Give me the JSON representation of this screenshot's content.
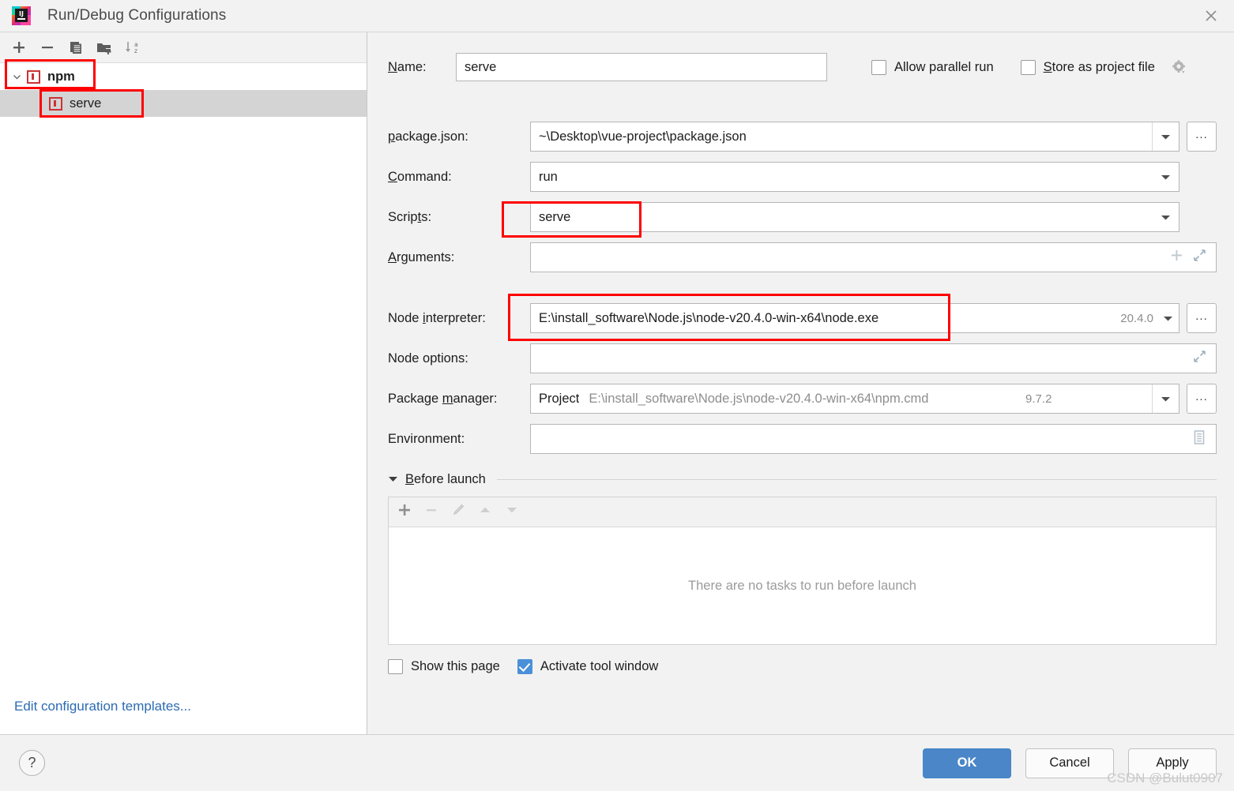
{
  "window": {
    "title": "Run/Debug Configurations",
    "logo_icon": "intellij-idea-logo",
    "close_icon": "close-icon"
  },
  "sidebar": {
    "toolbar": [
      {
        "name": "add-configuration-button",
        "icon": "plus-icon"
      },
      {
        "name": "remove-configuration-button",
        "icon": "minus-icon"
      },
      {
        "name": "copy-configuration-button",
        "icon": "copy-icon"
      },
      {
        "name": "new-folder-button",
        "icon": "folder-add-icon"
      },
      {
        "name": "sort-configurations-button",
        "icon": "sort-az-icon"
      }
    ],
    "tree": [
      {
        "label": "npm",
        "icon": "npm-icon",
        "level": 0,
        "expanded": true,
        "selected": false
      },
      {
        "label": "serve",
        "icon": "npm-icon",
        "level": 1,
        "expanded": false,
        "selected": true
      }
    ],
    "edit_templates_link": "Edit configuration templates..."
  },
  "form": {
    "name_label": "Name:",
    "name_value": "serve",
    "allow_parallel_run": {
      "label": "Allow parallel run",
      "checked": false
    },
    "store_as_project_file": {
      "label": "Store as project file",
      "checked": false,
      "gear_icon": "gear-icon"
    },
    "fields": {
      "package_json": {
        "label": "package.json:",
        "value": "~\\Desktop\\vue-project\\package.json",
        "dropdown_icon": "chevron-down-icon",
        "browse_label": "..."
      },
      "command": {
        "label": "Command:",
        "value": "run",
        "dropdown_icon": "chevron-down-icon"
      },
      "scripts": {
        "label": "Scripts:",
        "value": "serve",
        "dropdown_icon": "chevron-down-icon"
      },
      "arguments": {
        "label": "Arguments:",
        "value": "",
        "add_icon": "plus-icon",
        "expand_icon": "expand-icon"
      },
      "node_interpreter": {
        "label": "Node interpreter:",
        "value": "E:\\install_software\\Node.js\\node-v20.4.0-win-x64\\node.exe",
        "version": "20.4.0",
        "dropdown_icon": "chevron-down-icon",
        "browse_label": "..."
      },
      "node_options": {
        "label": "Node options:",
        "value": "",
        "expand_icon": "expand-icon"
      },
      "package_manager": {
        "label": "Package manager:",
        "value_primary": "Project",
        "value_secondary": "E:\\install_software\\Node.js\\node-v20.4.0-win-x64\\npm.cmd",
        "version": "9.7.2",
        "dropdown_icon": "chevron-down-icon",
        "browse_label": "..."
      },
      "environment": {
        "label": "Environment:",
        "value": "",
        "editor_icon": "environment-editor-icon"
      }
    }
  },
  "before_launch": {
    "title": "Before launch",
    "expanded": true,
    "collapse_icon": "triangle-down-icon",
    "toolbar": [
      {
        "name": "add-task-button",
        "icon": "plus-icon",
        "enabled": true
      },
      {
        "name": "remove-task-button",
        "icon": "minus-icon",
        "enabled": false
      },
      {
        "name": "edit-task-button",
        "icon": "pencil-icon",
        "enabled": false
      },
      {
        "name": "move-task-up-button",
        "icon": "triangle-up-icon",
        "enabled": false
      },
      {
        "name": "move-task-down-button",
        "icon": "triangle-down-icon",
        "enabled": false
      }
    ],
    "empty_text": "There are no tasks to run before launch",
    "show_this_page": {
      "label": "Show this page",
      "checked": false
    },
    "activate_tool_window": {
      "label": "Activate tool window",
      "checked": true
    }
  },
  "footer": {
    "help_label": "?",
    "ok_label": "OK",
    "cancel_label": "Cancel",
    "apply_label": "Apply"
  },
  "watermark": "CSDN @Bulut0907",
  "colors": {
    "accent_blue": "#4a86c8",
    "checkbox_checked": "#4a90d9",
    "link_blue": "#2c6bb3",
    "annotation_red": "#ff0000",
    "npm_icon_red": "#cc3333",
    "panel_bg": "#f2f2f2",
    "selection_gray": "#d4d4d4"
  }
}
